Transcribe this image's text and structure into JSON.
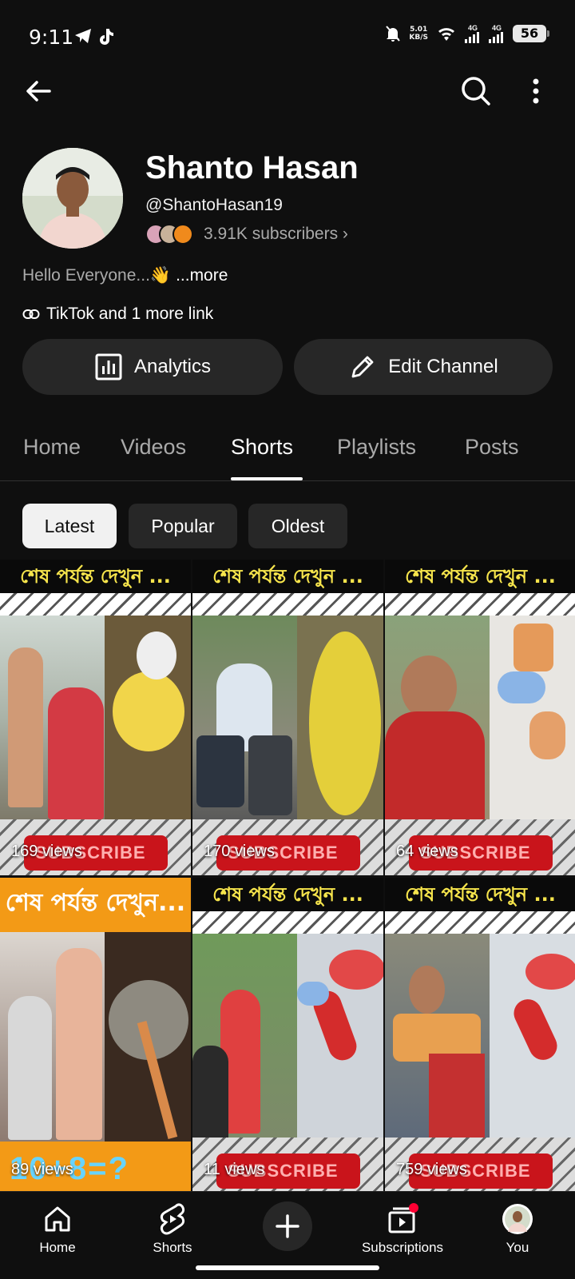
{
  "status": {
    "time": "9:11",
    "speed_top": "5.01",
    "speed_bottom": "KB/S",
    "net1": "4G",
    "net2": "4G",
    "battery": "56"
  },
  "channel": {
    "name": "Shanto Hasan",
    "handle": "@ShantoHasan19",
    "subscribers": "3.91K subscribers ›",
    "description": "Hello Everyone...👋",
    "more": "...more",
    "links": "TikTok and 1 more link"
  },
  "buttons": {
    "analytics": "Analytics",
    "edit_channel": "Edit Channel"
  },
  "tabs": [
    "Home",
    "Videos",
    "Shorts",
    "Playlists",
    "Posts"
  ],
  "active_tab": "Shorts",
  "chips": [
    "Latest",
    "Popular",
    "Oldest"
  ],
  "active_chip": "Latest",
  "shorts": [
    {
      "banner": "শেষ পর্যন্ত দেখুন ...",
      "views": "169 views",
      "sub_label": "SUBSCRIBE"
    },
    {
      "banner": "শেষ পর্যন্ত দেখুন ...",
      "views": "170 views",
      "sub_label": "SUBSCRIBE"
    },
    {
      "banner": "শেষ পর্যন্ত দেখুন ...",
      "views": "64 views",
      "sub_label": "SUBSCRIBE"
    },
    {
      "banner": "শেষ পর্যন্ত দেখুন...",
      "views": "89 views",
      "overlay": "10+8=?"
    },
    {
      "banner": "শেষ পর্যন্ত দেখুন ...",
      "views": "11 views",
      "sub_label": "SUBSCRIBE"
    },
    {
      "banner": "শেষ পর্যন্ত দেখুন ...",
      "views": "759 views",
      "sub_label": "SUBSCRIBE"
    }
  ],
  "bottom_nav": {
    "home": "Home",
    "shorts": "Shorts",
    "subscriptions": "Subscriptions",
    "you": "You"
  },
  "colors": {
    "background": "#0f0f0f",
    "chip_bg": "#272727",
    "subscribe_red": "#c9141b",
    "notification_dot": "#ff0033"
  }
}
